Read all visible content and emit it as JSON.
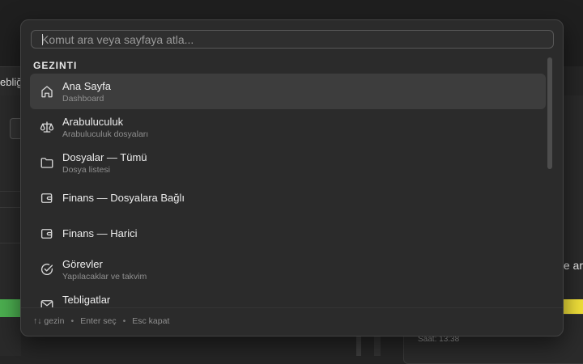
{
  "background": {
    "tab_fragment": "ebliğ",
    "right_fragment": "e ar",
    "bottom_card_text": "Saat: 13:38",
    "accent_green": "#4caf50",
    "accent_yellow": "#f2e13a"
  },
  "palette": {
    "search": {
      "placeholder": "Komut ara veya sayfaya atla...",
      "value": ""
    },
    "group_heading": "GEZINTI",
    "items": [
      {
        "title": "Ana Sayfa",
        "subtitle": "Dashboard",
        "icon": "home-icon",
        "active": true
      },
      {
        "title": "Arabuluculuk",
        "subtitle": "Arabuluculuk dosyaları",
        "icon": "scales-icon",
        "active": false
      },
      {
        "title": "Dosyalar — Tümü",
        "subtitle": "Dosya listesi",
        "icon": "folder-icon",
        "active": false
      },
      {
        "title": "Finans — Dosyalara Bağlı",
        "subtitle": "",
        "icon": "wallet-icon",
        "active": false
      },
      {
        "title": "Finans — Harici",
        "subtitle": "",
        "icon": "wallet-icon",
        "active": false
      },
      {
        "title": "Görevler",
        "subtitle": "Yapılacaklar ve takvim",
        "icon": "check-circle-icon",
        "active": false
      },
      {
        "title": "Tebligatlar",
        "subtitle": "",
        "icon": "mail-icon",
        "active": false
      }
    ],
    "footer": {
      "navigate": "↑↓ gezin",
      "select": "Enter seç",
      "close": "Esc kapat"
    }
  }
}
